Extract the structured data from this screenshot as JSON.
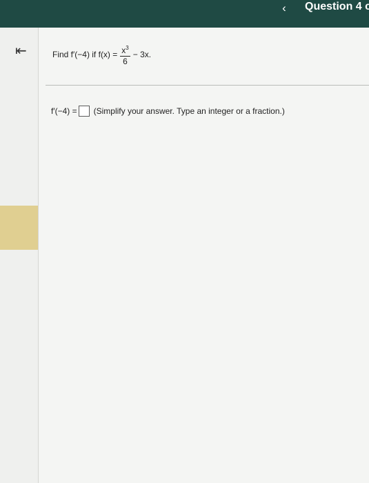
{
  "header": {
    "back_icon": "chevron-left-icon",
    "back_glyph": "‹",
    "question_title": "Question 4 c"
  },
  "sidebar": {
    "collapse_icon": "collapse-left-icon",
    "collapse_glyph": "⇤"
  },
  "question": {
    "prefix": "Find f′(−4) if f(x) =",
    "numerator_base": "x",
    "numerator_exponent": "3",
    "denominator": "6",
    "suffix": "− 3x."
  },
  "answer": {
    "label": "f′(−4) =",
    "value": "",
    "instruction": "(Simplify your answer. Type an integer or a fraction.)"
  }
}
